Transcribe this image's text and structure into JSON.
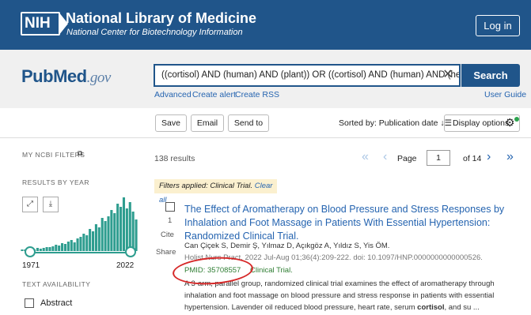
{
  "header": {
    "nih_logo": "NIH",
    "title": "National Library of Medicine",
    "subtitle": "National Center for Biotechnology Information",
    "login_label": "Log in",
    "bg_color": "#20558a"
  },
  "search": {
    "logo_pub": "Pub",
    "logo_med": "Med",
    "logo_gov": ".gov",
    "query": "((cortisol) AND (human) AND (plant)) OR ((cortisol) AND (human) AND (herb",
    "button_label": "Search",
    "links": {
      "advanced": "Advanced",
      "create_alert": "Create alert",
      "create_rss": "Create RSS",
      "user_guide": "User Guide"
    }
  },
  "actions": {
    "save": "Save",
    "email": "Email",
    "send_to": "Send to",
    "sorted_by": "Sorted by: Publication date",
    "display_options": "Display options"
  },
  "sidebar": {
    "my_ncbi": "MY NCBI FILTERS",
    "results_by_year": "RESULTS BY YEAR",
    "year_start": "1971",
    "year_end": "2022",
    "text_availability": "TEXT AVAILABILITY",
    "abstract": "Abstract",
    "histogram_color": "#2e9d8f"
  },
  "results": {
    "count": "138 results",
    "page_label": "Page",
    "page_value": "1",
    "of_pages": "of 14",
    "filters_text": "Filters applied: Clinical Trial.",
    "clear_all": "Clear all"
  },
  "item": {
    "number": "1",
    "cite": "Cite",
    "share": "Share",
    "title": "The Effect of Aromatherapy on Blood Pressure and Stress Responses by Inhalation and Foot Massage in Patients With Essential Hypertension: Randomized Clinical Trial.",
    "authors": "Can Çiçek S, Demir Ş, Yılmaz D, Açıkgöz A, Yıldız S, Yis ÖM.",
    "journal": "Holist Nurs Pract. 2022 Jul-Aug 01;36(4):209-222. doi: 10.1097/HNP.0000000000000526.",
    "pmid": "PMID: 35708557",
    "type": "Clinical Trial.",
    "snippet_pre": "A 3-arm, parallel group, randomized clinical trial examines the effect of aromatherapy through inhalation and foot massage on blood pressure and stress response in patients with essential hypertension. Lavender oil reduced blood pressure, heart rate, serum ",
    "snippet_bold": "cortisol",
    "snippet_post": ", and su ..."
  }
}
